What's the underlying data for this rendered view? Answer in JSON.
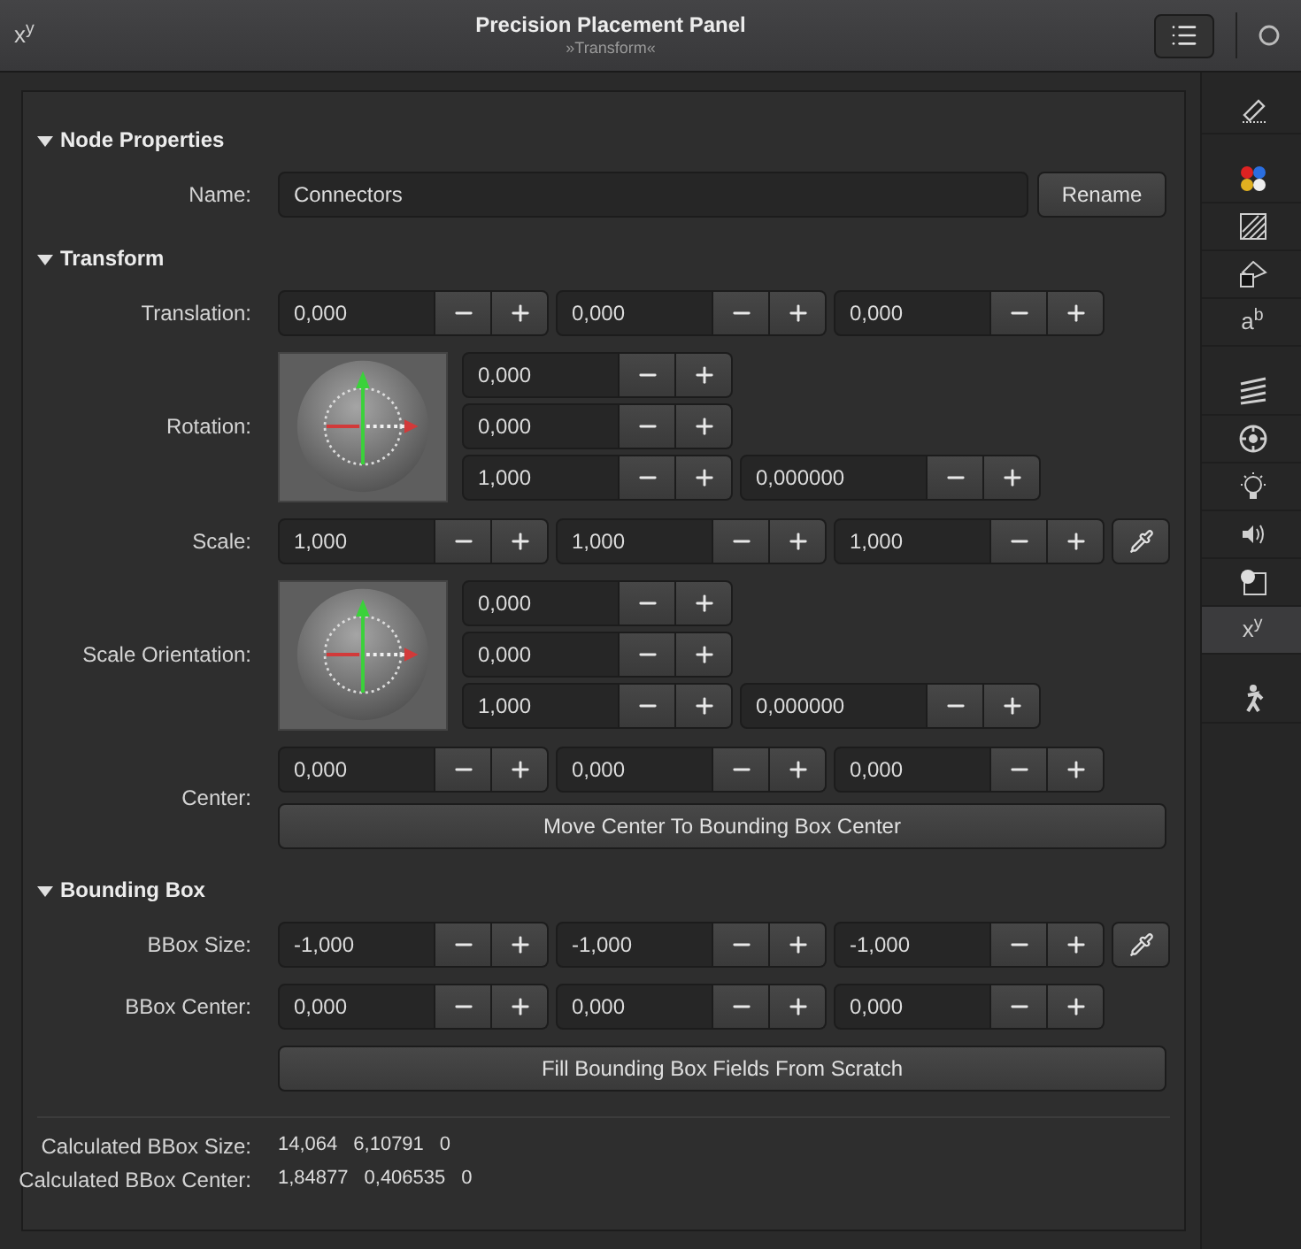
{
  "window": {
    "corner_glyph": "x$^{y}$",
    "title": "Precision Placement Panel",
    "subtitle": "»Transform«"
  },
  "sections": [
    {
      "title": "Node Properties",
      "expanded": true,
      "rows": [
        {
          "kind": "name",
          "label": "Name:",
          "value": "Connectors",
          "button": "Rename"
        }
      ]
    },
    {
      "title": "Transform",
      "expanded": true,
      "rows": [
        {
          "kind": "vector",
          "label": "Translation:",
          "values": [
            "0,000",
            "0,000",
            "0,000"
          ],
          "picker": false
        },
        {
          "kind": "rotation",
          "label": "Rotation:",
          "values": [
            "0,000",
            "0,000",
            "1,000"
          ],
          "angle": "0,000000"
        },
        {
          "kind": "vector",
          "label": "Scale:",
          "values": [
            "1,000",
            "1,000",
            "1,000"
          ],
          "picker": true
        },
        {
          "kind": "rotation",
          "label": "Scale Orientation:",
          "values": [
            "0,000",
            "0,000",
            "1,000"
          ],
          "angle": "0,000000"
        },
        {
          "kind": "vector",
          "label": "Center:",
          "values": [
            "0,000",
            "0,000",
            "0,000"
          ],
          "picker": false,
          "action": "Move Center To Bounding Box Center"
        }
      ]
    },
    {
      "title": "Bounding Box",
      "expanded": true,
      "rows": [
        {
          "kind": "vector",
          "label": "BBox Size:",
          "values": [
            "-1,000",
            "-1,000",
            "-1,000"
          ],
          "picker": true
        },
        {
          "kind": "vector",
          "label": "BBox Center:",
          "values": [
            "0,000",
            "0,000",
            "0,000"
          ],
          "picker": false
        },
        {
          "kind": "button",
          "label": "Fill Bounding Box Fields From Scratch"
        }
      ]
    }
  ],
  "readouts": [
    {
      "label": "Calculated BBox Size:",
      "values": [
        "14,064",
        "6,10791",
        "0"
      ]
    },
    {
      "label": "Calculated BBox Center:",
      "values": [
        "1,84877",
        "0,406535",
        "0"
      ]
    }
  ],
  "sidebar": {
    "groups": [
      [
        {
          "kind": "pencil",
          "selected": false
        }
      ],
      [
        {
          "kind": "colors",
          "selected": false
        },
        {
          "kind": "hatch",
          "selected": false
        },
        {
          "kind": "shapes",
          "selected": false
        },
        {
          "kind": "glyph",
          "glyph": "a$^{b}$",
          "selected": false
        }
      ],
      [
        {
          "kind": "layers",
          "selected": false
        },
        {
          "kind": "target",
          "selected": false
        },
        {
          "kind": "bulb",
          "selected": false
        },
        {
          "kind": "sound",
          "selected": false
        },
        {
          "kind": "image",
          "selected": false
        },
        {
          "kind": "glyph",
          "glyph": "x$^{y}$",
          "selected": true
        }
      ],
      [
        {
          "kind": "figure",
          "selected": false
        }
      ]
    ]
  }
}
